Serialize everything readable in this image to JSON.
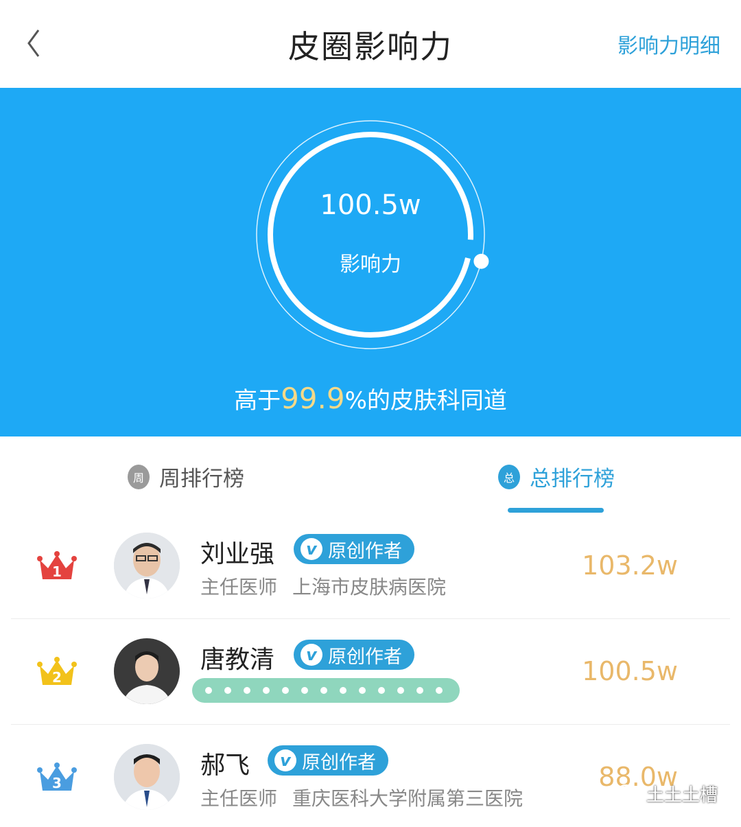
{
  "header": {
    "title": "皮圈影响力",
    "detail_link": "影响力明细"
  },
  "hero": {
    "score": "100.5w",
    "score_label": "影响力",
    "compare_prefix": "高于",
    "compare_percent": "99.9",
    "compare_suffix": "%的皮肤科同道",
    "progress_fraction": 0.97,
    "colors": {
      "background": "#1ea9f5",
      "percent": "#f3d989"
    }
  },
  "tabs": [
    {
      "label": "周排行榜",
      "badge": "周",
      "active": false
    },
    {
      "label": "总排行榜",
      "badge": "总",
      "active": true
    }
  ],
  "ranking": [
    {
      "rank": "1",
      "name": "刘业强",
      "tag": "原创作者",
      "title": "主任医师",
      "hospital": "上海市皮肤病医院",
      "value": "103.2w",
      "crown_color": "#e4433f"
    },
    {
      "rank": "2",
      "name": "唐教清",
      "tag": "原创作者",
      "title": "",
      "hospital": "",
      "value": "100.5w",
      "crown_color": "#f2c21b"
    },
    {
      "rank": "3",
      "name": "郝飞",
      "tag": "原创作者",
      "title": "主任医师",
      "hospital": "重庆医科大学附属第三医院",
      "value": "88.0w",
      "crown_color": "#4a9de0"
    }
  ],
  "watermark": "土土土槽"
}
